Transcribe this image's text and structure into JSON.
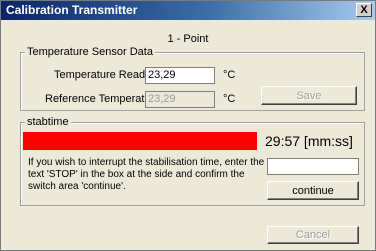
{
  "window": {
    "title": "Calibration Transmitter",
    "close_label": "X"
  },
  "mode": {
    "label": "1 - Point"
  },
  "sensor_group": {
    "legend": "Temperature Sensor Data",
    "temperature_reading": {
      "label": "Temperature Reading",
      "value": "23,29",
      "unit": "°C"
    },
    "reference_temperature": {
      "label": "Reference Temperature",
      "value": "23,29",
      "unit": "°C"
    },
    "save_label": "Save"
  },
  "stab_group": {
    "legend": "stabtime",
    "timer": "29:57 [mm:ss]",
    "progress_color": "#ff0000",
    "info_text": "If you wish to interrupt the stabilisation time, enter the text 'STOP' in the box at the side and confirm the switch area 'continue'.",
    "stop_input_value": "",
    "continue_label": "continue"
  },
  "footer": {
    "cancel_label": "Cancel"
  }
}
